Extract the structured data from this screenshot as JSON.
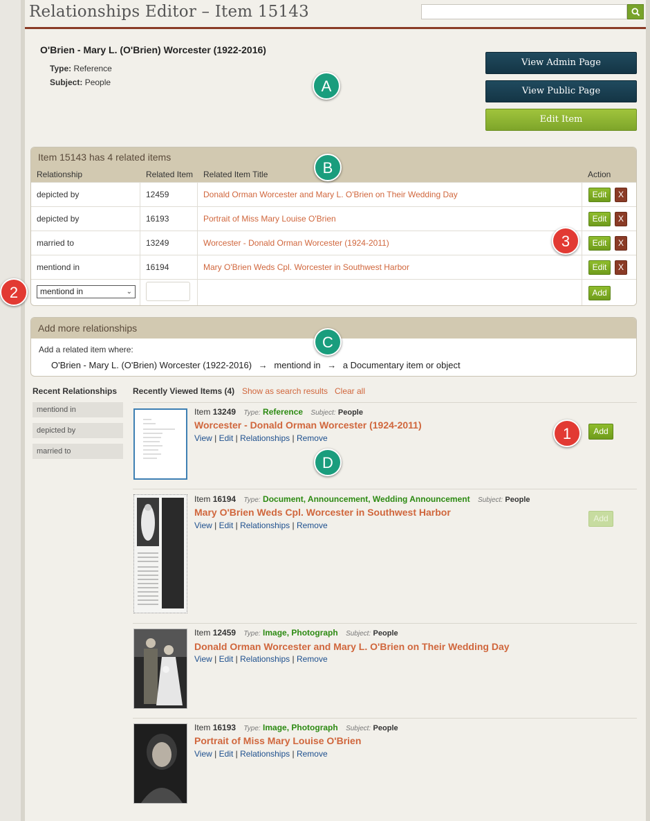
{
  "header": {
    "title": "Relationships Editor – Item 15143",
    "search_placeholder": ""
  },
  "item": {
    "name": "O'Brien - Mary L. (O'Brien) Worcester (1922-2016)",
    "type_label": "Type:",
    "type_value": "Reference",
    "subject_label": "Subject:",
    "subject_value": "People"
  },
  "buttons": {
    "view_admin": "View Admin Page",
    "view_public": "View Public Page",
    "edit_item": "Edit Item"
  },
  "markers": {
    "a": "A",
    "b": "B",
    "c": "C",
    "d": "D",
    "one": "1",
    "two": "2",
    "three": "3"
  },
  "related": {
    "heading": "Item 15143 has 4 related items",
    "columns": [
      "Relationship",
      "Related Item",
      "Related Item Title",
      "Action"
    ],
    "rows": [
      {
        "relationship": "depicted by",
        "item": "12459",
        "title": "Donald Orman Worcester and Mary L. O'Brien on Their Wedding Day"
      },
      {
        "relationship": "depicted by",
        "item": "16193",
        "title": "Portrait of Miss Mary Louise O'Brien"
      },
      {
        "relationship": "married to",
        "item": "13249",
        "title": "Worcester - Donald Orman Worcester (1924-2011)"
      },
      {
        "relationship": "mentiond in",
        "item": "16194",
        "title": "Mary O'Brien Weds Cpl. Worcester in Southwest Harbor"
      }
    ],
    "edit_label": "Edit",
    "delete_label": "X",
    "new_row": {
      "selected": "mentiond in",
      "item_value": "",
      "add_label": "Add"
    }
  },
  "add_more": {
    "heading": "Add more relationships",
    "intro": "Add a related item where:",
    "subject": "O'Brien - Mary L. (O'Brien) Worcester (1922-2016)",
    "arrow": "→",
    "relationship": "mentiond in",
    "object": "a Documentary item or object"
  },
  "recent_relationships": {
    "title": "Recent Relationships",
    "items": [
      "mentiond in",
      "depicted by",
      "married to"
    ]
  },
  "recently_viewed": {
    "title": "Recently Viewed Items (4)",
    "show_link": "Show as search results",
    "clear_link": "Clear all",
    "type_label": "Type:",
    "subject_label": "Subject:",
    "actions": [
      "View",
      "Edit",
      "Relationships",
      "Remove"
    ],
    "add_label": "Add",
    "items": [
      {
        "prefix": "Item",
        "number": "13249",
        "type": "Reference",
        "subject": "People",
        "title": "Worcester - Donald Orman Worcester (1924-2011)",
        "add_enabled": true
      },
      {
        "prefix": "Item",
        "number": "16194",
        "type": "Document, Announcement, Wedding Announcement",
        "subject": "People",
        "title": "Mary O'Brien Weds Cpl. Worcester in Southwest Harbor",
        "add_enabled": false
      },
      {
        "prefix": "Item",
        "number": "12459",
        "type": "Image, Photograph",
        "subject": "People",
        "title": "Donald Orman Worcester and Mary L. O'Brien on Their Wedding Day"
      },
      {
        "prefix": "Item",
        "number": "16193",
        "type": "Image, Photograph",
        "subject": "People",
        "title": "Portrait of Miss Mary Louise O'Brien"
      }
    ]
  },
  "colors": {
    "accent_link": "#d0663c",
    "dark_button": "#1a4052",
    "green_button": "#8bb432",
    "delete_button": "#8a3b26",
    "panel_header": "#d2c9b1",
    "marker_teal": "#1a9d7d",
    "marker_red": "#e23a33"
  }
}
